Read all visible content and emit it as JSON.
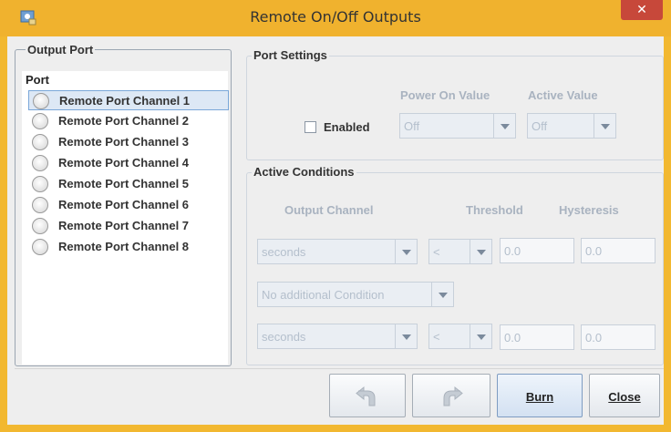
{
  "window": {
    "title": "Remote On/Off Outputs",
    "close_label": "✕",
    "accent_color": "#f0b22e"
  },
  "output_port": {
    "legend": "Output Port",
    "list_header": "Port",
    "items": [
      {
        "label": "Remote Port Channel 1",
        "selected": true
      },
      {
        "label": "Remote Port Channel 2",
        "selected": false
      },
      {
        "label": "Remote Port Channel 3",
        "selected": false
      },
      {
        "label": "Remote Port Channel 4",
        "selected": false
      },
      {
        "label": "Remote Port Channel 5",
        "selected": false
      },
      {
        "label": "Remote Port Channel 6",
        "selected": false
      },
      {
        "label": "Remote Port Channel 7",
        "selected": false
      },
      {
        "label": "Remote Port Channel 8",
        "selected": false
      }
    ]
  },
  "port_settings": {
    "legend": "Port Settings",
    "power_on_value_label": "Power On Value",
    "active_value_label": "Active Value",
    "enabled_label": "Enabled",
    "enabled_checked": false,
    "power_on_value": "Off",
    "active_value": "Off"
  },
  "active_conditions": {
    "legend": "Active Conditions",
    "output_channel_label": "Output Channel",
    "threshold_label": "Threshold",
    "hysteresis_label": "Hysteresis",
    "row1": {
      "channel": "seconds",
      "operator": "<",
      "threshold": "0.0",
      "hysteresis": "0.0"
    },
    "additional_condition": "No additional Condition",
    "row2": {
      "channel": "seconds",
      "operator": "<",
      "threshold": "0.0",
      "hysteresis": "0.0"
    }
  },
  "buttons": {
    "undo_icon": "undo-icon",
    "redo_icon": "redo-icon",
    "burn_label": "Burn",
    "close_label": "Close"
  }
}
